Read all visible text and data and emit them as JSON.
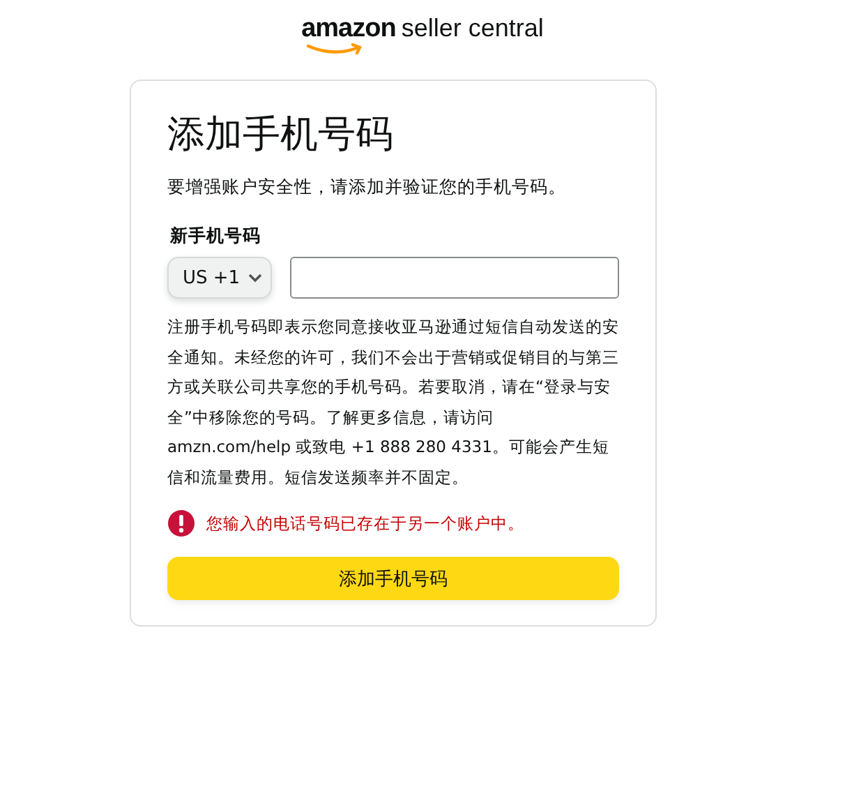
{
  "logo": {
    "brand": "amazon",
    "product": "seller central"
  },
  "card": {
    "title": "添加手机号码",
    "subtitle": "要增强账户安全性，请添加并验证您的手机号码。",
    "field_label": "新手机号码",
    "country_code": "US +1",
    "notice": "注册手机号码即表示您同意接收亚马逊通过短信自动发送的安全通知。未经您的许可，我们不会出于营销或促销目的与第三方或关联公司共享您的手机号码。若要取消，请在“登录与安全”中移除您的号码。了解更多信息，请访问 amzn.com/help 或致电 +1 888 280 4331。可能会产生短信和流量费用。短信发送频率并不固定。",
    "error": "您输入的电话号码已存在于另一个账户中。",
    "submit": "添加手机号码"
  }
}
